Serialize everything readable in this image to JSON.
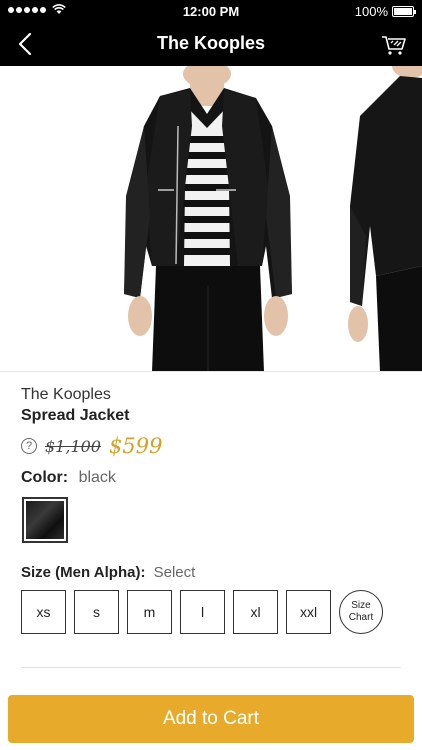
{
  "status_bar": {
    "time": "12:00 PM",
    "battery": "100%"
  },
  "header": {
    "title": "The Kooples"
  },
  "product": {
    "brand": "The Kooples",
    "name": "Spread Jacket",
    "help_icon": "?",
    "original_price": "$1,100",
    "sale_price": "$599",
    "price_color": "#d4a126"
  },
  "color": {
    "label": "Color:",
    "value": "black"
  },
  "size": {
    "label": "Size (Men Alpha):",
    "value": "Select",
    "options": [
      "xs",
      "s",
      "m",
      "l",
      "xl",
      "xxl"
    ],
    "chart_line1": "Size",
    "chart_line2": "Chart"
  },
  "cta": {
    "add_to_cart": "Add to Cart",
    "color": "#e8aa2a"
  },
  "icons": [
    "back-chevron-icon",
    "shopping-cart-icon",
    "wifi-icon",
    "battery-icon",
    "help-icon"
  ]
}
